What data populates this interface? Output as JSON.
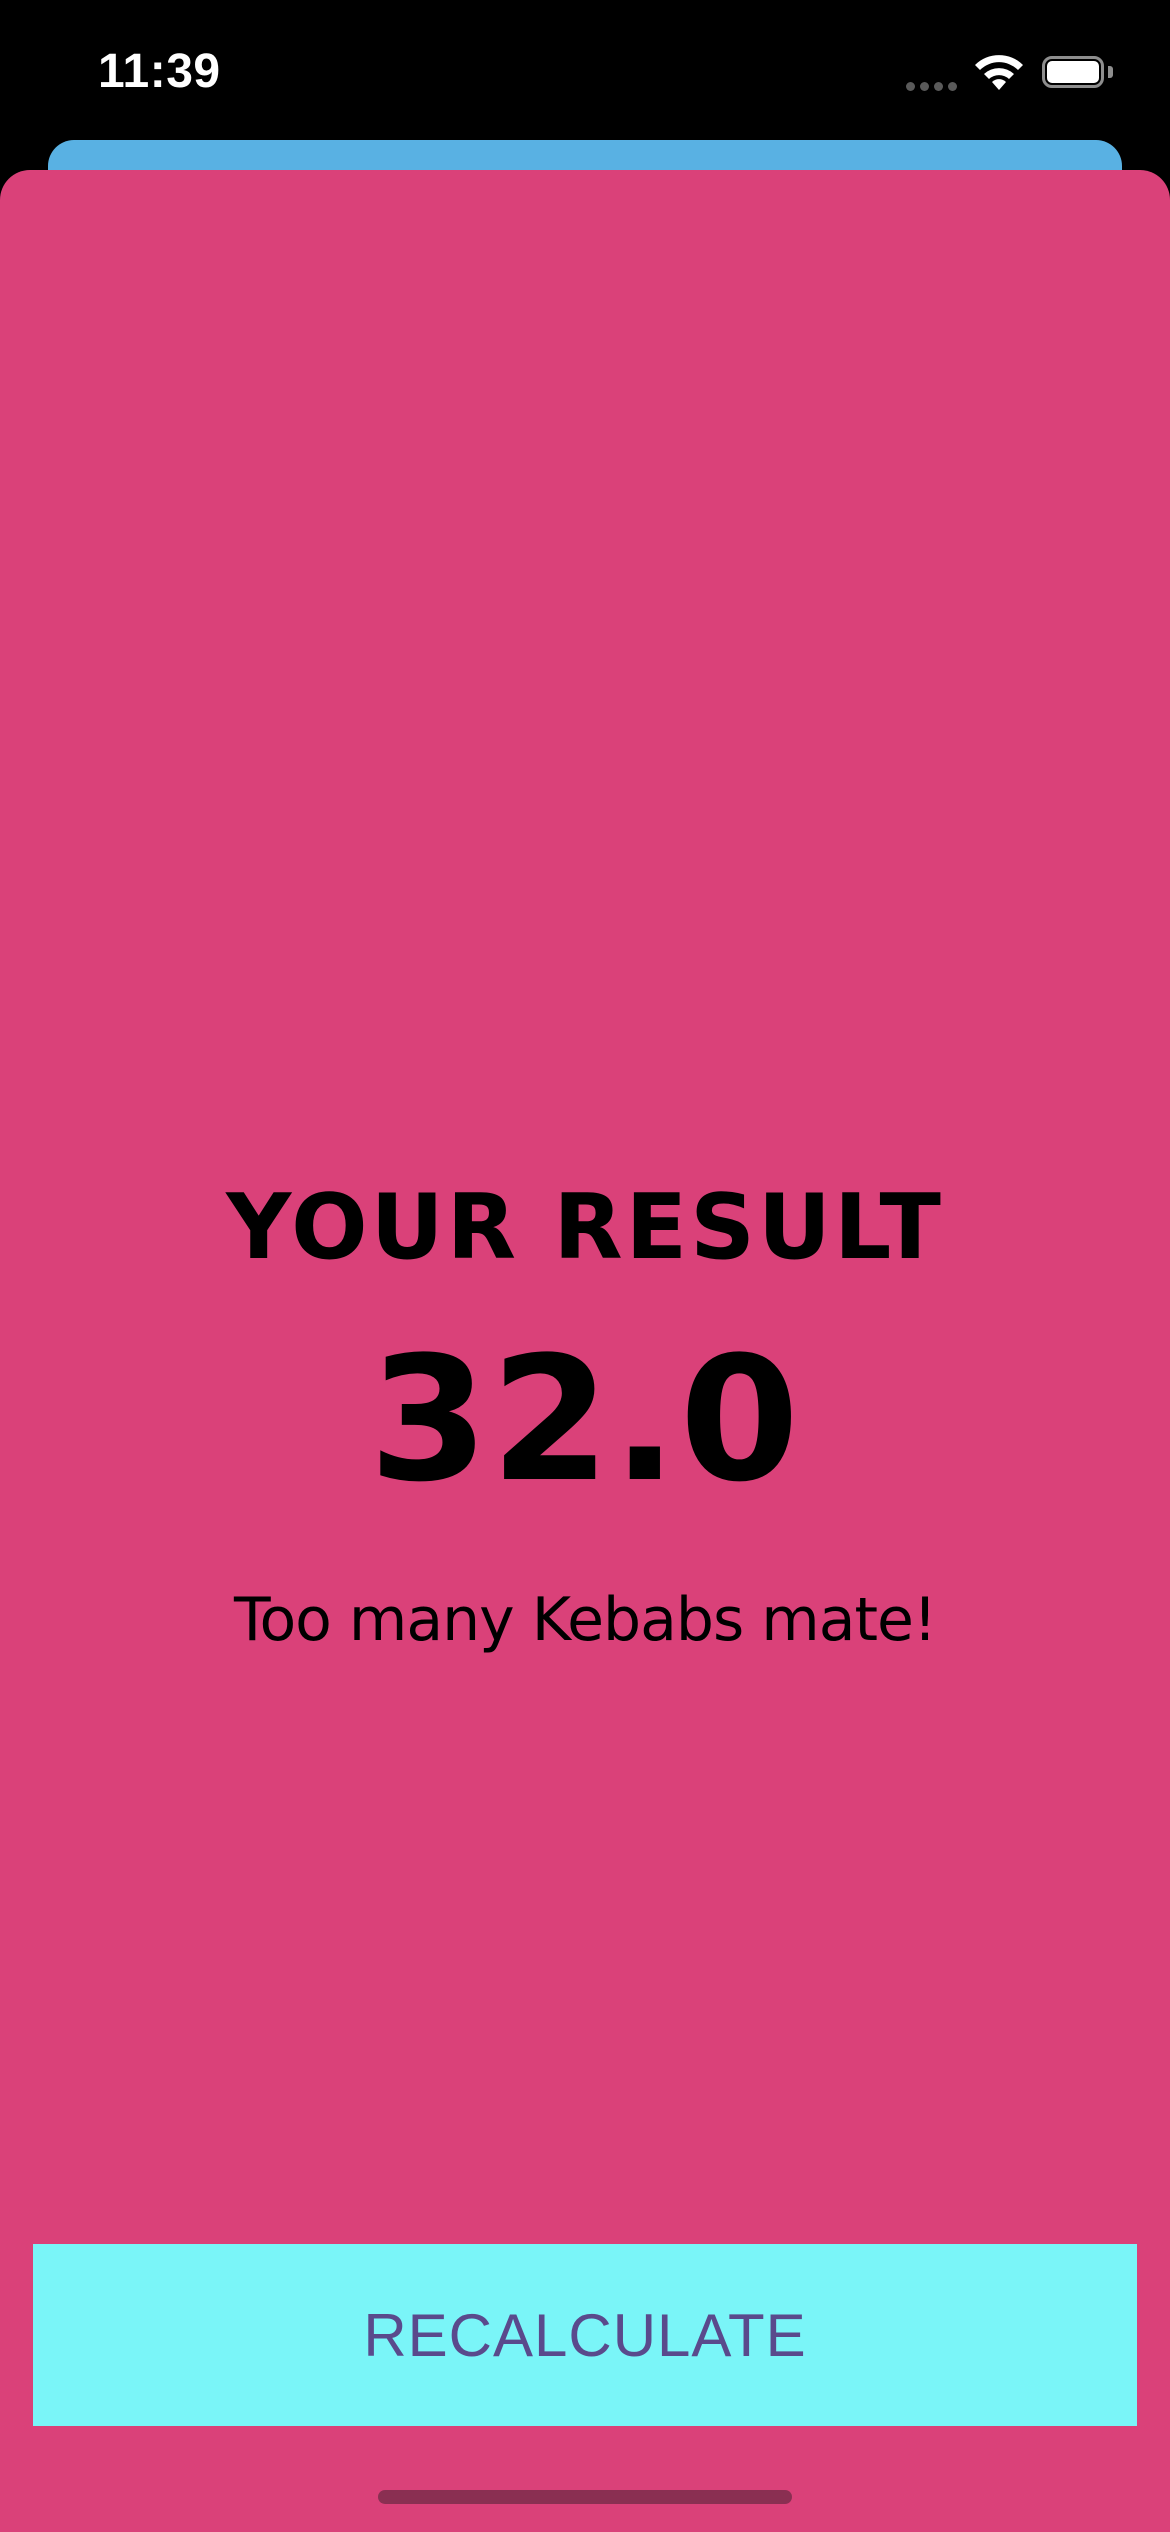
{
  "status_bar": {
    "time": "11:39",
    "icons": [
      "cellular-signal-icon",
      "wifi-icon",
      "battery-icon"
    ]
  },
  "colors": {
    "background_sheet": "#59b1e3",
    "result_sheet": "#da4179",
    "button_background": "#7af5f8",
    "button_text": "#5a4a8c",
    "text": "#000000"
  },
  "result": {
    "title": "YOUR RESULT",
    "value": "32.0",
    "advice": "Too many Kebabs mate!"
  },
  "actions": {
    "recalculate_label": "RECALCULATE"
  }
}
